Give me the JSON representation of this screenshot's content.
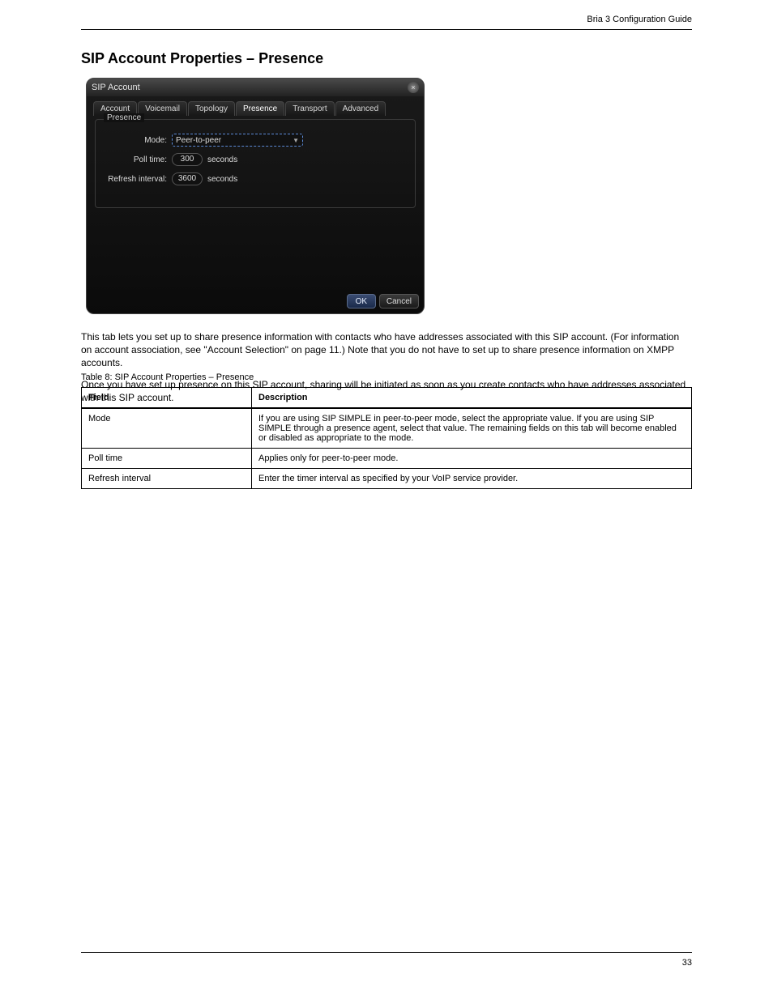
{
  "header": {
    "right": "Bria 3 Configuration Guide",
    "page_heading": "SIP Account Properties – Presence"
  },
  "dialog": {
    "title": "SIP Account",
    "tabs": [
      "Account",
      "Voicemail",
      "Topology",
      "Presence",
      "Transport",
      "Advanced"
    ],
    "active_tab_index": 3,
    "group_title": "Presence",
    "mode": {
      "label": "Mode:",
      "value": "Peer-to-peer"
    },
    "poll": {
      "label": "Poll time:",
      "value": "300",
      "units": "seconds"
    },
    "refresh": {
      "label": "Refresh interval:",
      "value": "3600",
      "units": "seconds"
    },
    "ok": "OK",
    "cancel": "Cancel"
  },
  "body": {
    "para1": "This tab lets you set up to share presence information with contacts who have addresses associated with this SIP account. (For information on account association, see \"Account Selection\" on page 11.) Note that you do not have to set up to share presence information on XMPP accounts.",
    "para2": "Once you have set up presence on this SIP account, sharing will be initiated as soon as you create contacts who have addresses associated with this SIP account.",
    "table_caption": "Table 8: SIP Account Properties – Presence"
  },
  "table": {
    "headers": [
      "Field",
      "Description"
    ],
    "rows": [
      {
        "field": "Mode",
        "desc": "If you are using SIP SIMPLE in peer-to-peer mode, select the appropriate value. If you are using SIP SIMPLE through a presence agent, select that value. The remaining fields on this tab will become enabled or disabled as appropriate to the mode."
      },
      {
        "field": "Poll time",
        "desc": "Applies only for peer-to-peer mode."
      },
      {
        "field": "Refresh interval",
        "desc": "Enter the timer interval as specified by your VoIP service provider."
      }
    ]
  },
  "footer": {
    "page": "33"
  }
}
